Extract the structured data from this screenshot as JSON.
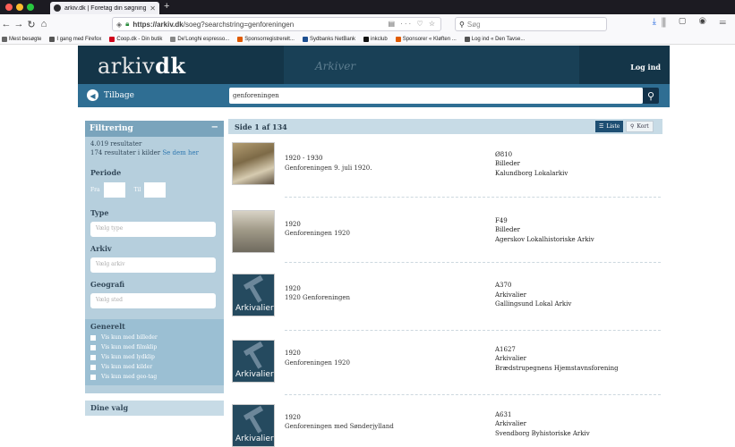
{
  "browser": {
    "tab_title": "arkiv.dk | Foretag din søgning",
    "url_host": "https://arkiv.dk",
    "url_path": "/soeg?searchstring=genforeningen",
    "search_placeholder": "Søg",
    "bookmarks": [
      {
        "label": "Mest besøgte",
        "color": "#666666"
      },
      {
        "label": "I gang med Firefox",
        "color": "#555555"
      },
      {
        "label": "Coop.dk - Din butik",
        "color": "#d0021b"
      },
      {
        "label": "De'Longhi espresso...",
        "color": "#888888"
      },
      {
        "label": "Sponsorregistrerelt...",
        "color": "#e05a00"
      },
      {
        "label": "Sydbanks NetBank",
        "color": "#1d4f91"
      },
      {
        "label": "inkclub",
        "color": "#111111"
      },
      {
        "label": "Sponsorer « Kløften ...",
        "color": "#e05a00"
      },
      {
        "label": "Log ind « Den Tavse...",
        "color": "#555555"
      }
    ]
  },
  "site": {
    "logo_a": "arkiv",
    "logo_b": "dk",
    "script_text": "Arkiver",
    "login": "Log ind",
    "back_label": "Tilbage",
    "search_value": "genforeningen"
  },
  "sidebar": {
    "title": "Filtrering",
    "results": "4.019 resultater",
    "sources": "174 resultater i kilder",
    "sources_link": "Se dem her",
    "period_label": "Periode",
    "from_label": "Fra",
    "to_label": "Til",
    "type_label": "Type",
    "type_placeholder": "Vælg type",
    "archive_label": "Arkiv",
    "archive_placeholder": "Vælg arkiv",
    "geo_label": "Geografi",
    "geo_placeholder": "Vælg sted",
    "general_label": "Generelt",
    "checkboxes": [
      "Vis kun med billeder",
      "Vis kun med filmklip",
      "Vis kun med lydklip",
      "Vis kun med kilder",
      "Vis kun med geo-tag"
    ],
    "dine_valg": "Dine valg"
  },
  "results_bar": {
    "page": "Side 1 af 134",
    "list_label": "Liste",
    "map_label": "Kort"
  },
  "results": [
    {
      "year": "1920 - 1930",
      "title": "Genforeningen 9. juli 1920.",
      "id": "Ø810",
      "type": "Billeder",
      "archive": "Kalundborg Lokalarkiv",
      "thumb": "photo1"
    },
    {
      "year": "1920",
      "title": "Genforeningen 1920",
      "id": "F49",
      "type": "Billeder",
      "archive": "Agerskov Lokalhistoriske Arkiv",
      "thumb": "photo2"
    },
    {
      "year": "1920",
      "title": "1920 Genforeningen",
      "id": "A370",
      "type": "Arkivalier",
      "archive": "Gallingsund Lokal Arkiv",
      "thumb": "ark"
    },
    {
      "year": "1920",
      "title": "Genforeningen 1920",
      "id": "A1627",
      "type": "Arkivalier",
      "archive": "Brædstrupegnens Hjemstavnsforening",
      "thumb": "ark"
    },
    {
      "year": "1920",
      "title": "Genforeningen med Sønderjylland",
      "id": "A631",
      "type": "Arkivalier",
      "archive": "Svendborg Byhistoriske Arkiv",
      "thumb": "ark"
    }
  ],
  "thumb_label": "Arkivalier"
}
